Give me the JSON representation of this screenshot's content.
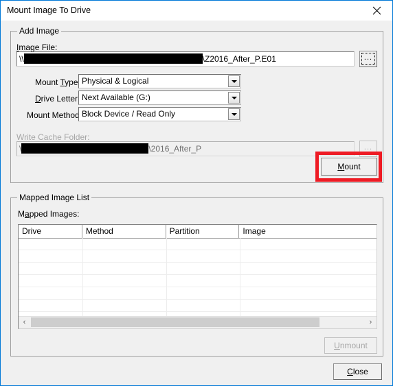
{
  "window": {
    "title": "Mount Image To Drive",
    "close_icon": "close-icon",
    "border_color": "#0078d7"
  },
  "add_image_group": {
    "legend": "Add Image",
    "image_file": {
      "label_prefix": "I",
      "label_rest": "mage File:",
      "label_full": "Image File:",
      "value_prefix": "\\\\",
      "value_suffix": "\\Z2016_After_P.E01",
      "redacted": true
    },
    "browse_button": {
      "label": "...",
      "name": "browse-image-file-button",
      "focused": true
    },
    "mount_type": {
      "label_pre": "Mount ",
      "label_key": "T",
      "label_post": "ype:",
      "label_full": "Mount Type:",
      "value": "Physical & Logical"
    },
    "drive_letter": {
      "label_pre": "",
      "label_key": "D",
      "label_post": "rive Letter:",
      "label_full": "Drive Letter:",
      "value": "Next Available (G:)"
    },
    "mount_method": {
      "label_pre": "Mount Method:",
      "label_key": "",
      "label_post": "",
      "label_full": "Mount Method:",
      "value": "Block Device / Read Only"
    },
    "write_cache": {
      "label": "Write Cache Folder:",
      "disabled": true,
      "value_prefix": "\\",
      "value_suffix": "\\2016_After_P",
      "redacted": true
    },
    "write_cache_browse_button": {
      "label": "...",
      "disabled": true
    },
    "mount_button": {
      "label_pre": "M",
      "label_post": "ount",
      "label_full": "Mount"
    }
  },
  "annotation": {
    "color": "#ee1b24",
    "target": "mount-button"
  },
  "mapped_image_list_group": {
    "legend": "Mapped Image List",
    "list_label_pre": "M",
    "list_label_key": "a",
    "list_label_post": "pped Images:",
    "list_label_full": "Mapped Images:",
    "columns": [
      "Drive",
      "Method",
      "Partition",
      "Image"
    ],
    "rows": [],
    "row_count_visible": 8,
    "scrollbar": {
      "left_arrow": "‹",
      "right_arrow": "›"
    },
    "unmount_button": {
      "label_pre": "U",
      "label_post": "nmount",
      "label_full": "Unmount",
      "disabled": true
    }
  },
  "footer": {
    "close_button": {
      "label_pre": "C",
      "label_post": "lose",
      "label_full": "Close"
    }
  }
}
